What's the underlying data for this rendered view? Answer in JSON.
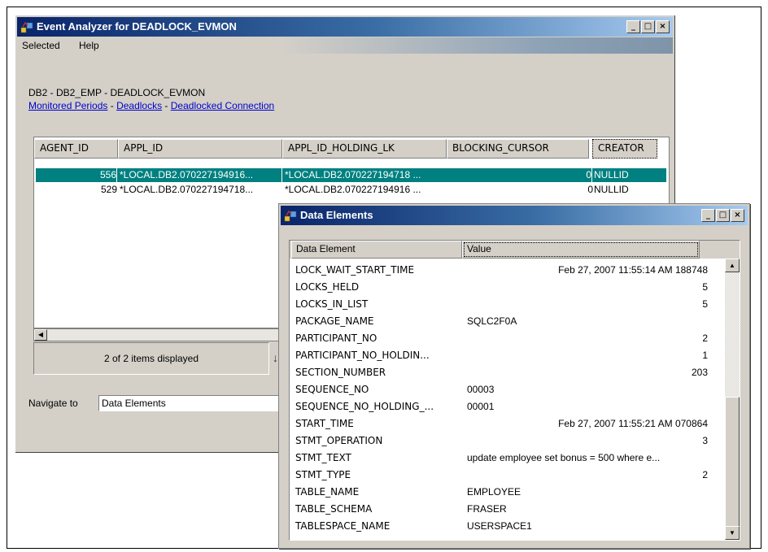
{
  "main_window": {
    "title": "Event Analyzer for DEADLOCK_EVMON",
    "controls": {
      "minimize": "_",
      "maximize": "□",
      "close": "×"
    },
    "menu": [
      "Selected",
      "Help"
    ],
    "context_path": "DB2 - DB2_EMP - DEADLOCK_EVMON",
    "breadcrumb": {
      "link1": "Monitored Periods",
      "link2": "Deadlocks",
      "link3": "Deadlocked Connection",
      "separator": " - "
    },
    "table": {
      "columns": [
        "AGENT_ID",
        "APPL_ID",
        "APPL_ID_HOLDING_LK",
        "BLOCKING_CURSOR",
        "CREATOR"
      ],
      "rows": [
        {
          "agent_id": "556",
          "appl_id": "*LOCAL.DB2.070227194916...",
          "appl_id_holding_lk": "*LOCAL.DB2.070227194718 ...",
          "blocking_cursor": "0",
          "creator": "NULLID",
          "selected": true
        },
        {
          "agent_id": "529",
          "appl_id": "*LOCAL.DB2.070227194718...",
          "appl_id_holding_lk": "*LOCAL.DB2.070227194916 ...",
          "blocking_cursor": "0",
          "creator": "NULLID",
          "selected": false
        }
      ]
    },
    "status": "2 of 2 items displayed",
    "navigate_label": "Navigate to",
    "navigate_value": "Data Elements"
  },
  "data_window": {
    "title": "Data Elements",
    "controls": {
      "minimize": "_",
      "maximize": "□",
      "close": "×"
    },
    "columns": [
      "Data Element",
      "Value"
    ],
    "rows": [
      {
        "name": "LOCK_WAIT_START_TIME",
        "value": "Feb 27, 2007 11:55:14 AM 188748",
        "align": "right"
      },
      {
        "name": "LOCKS_HELD",
        "value": "5",
        "align": "right"
      },
      {
        "name": "LOCKS_IN_LIST",
        "value": "5",
        "align": "right"
      },
      {
        "name": "PACKAGE_NAME",
        "value": "SQLC2F0A",
        "align": "left"
      },
      {
        "name": "PARTICIPANT_NO",
        "value": "2",
        "align": "right"
      },
      {
        "name": "PARTICIPANT_NO_HOLDIN...",
        "value": "1",
        "align": "right"
      },
      {
        "name": "SECTION_NUMBER",
        "value": "203",
        "align": "right"
      },
      {
        "name": "SEQUENCE_NO",
        "value": "00003",
        "align": "left"
      },
      {
        "name": "SEQUENCE_NO_HOLDING_...",
        "value": "00001",
        "align": "left"
      },
      {
        "name": "START_TIME",
        "value": "Feb 27, 2007 11:55:21 AM 070864",
        "align": "right"
      },
      {
        "name": "STMT_OPERATION",
        "value": "3",
        "align": "right"
      },
      {
        "name": "STMT_TEXT",
        "value": "update employee set bonus = 500 where e...",
        "align": "left"
      },
      {
        "name": "STMT_TYPE",
        "value": "2",
        "align": "right"
      },
      {
        "name": "TABLE_NAME",
        "value": "EMPLOYEE",
        "align": "left"
      },
      {
        "name": "TABLE_SCHEMA",
        "value": "FRASER",
        "align": "left"
      },
      {
        "name": "TABLESPACE_NAME",
        "value": "USERSPACE1",
        "align": "left"
      }
    ]
  },
  "colors": {
    "selection": "#008080",
    "title_active": "#0a246a",
    "face": "#d4d0c8",
    "link": "#0000cc"
  },
  "icons": {
    "app": "event-analyzer-icon",
    "sort": "sort-icon"
  }
}
